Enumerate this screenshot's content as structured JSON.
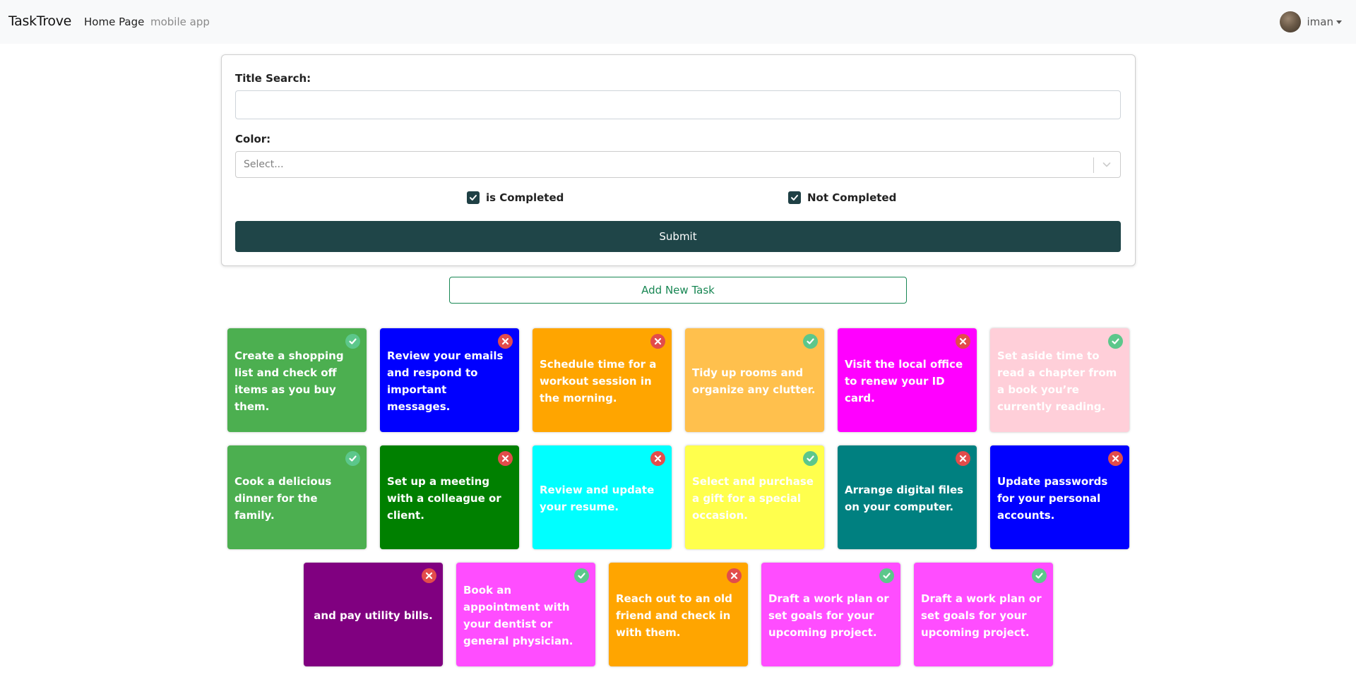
{
  "navbar": {
    "brand": "TaskTrove",
    "links": [
      {
        "label": "Home Page"
      },
      {
        "label": "mobile app"
      }
    ],
    "user": {
      "name": "iman"
    }
  },
  "filter": {
    "title_label": "Title Search:",
    "title_value": "",
    "color_label": "Color:",
    "color_placeholder": "Select...",
    "completed_label": "is Completed",
    "completed_checked": true,
    "not_completed_label": "Not Completed",
    "not_completed_checked": true,
    "submit_label": "Submit"
  },
  "add_task_label": "Add New Task",
  "tasks": [
    {
      "text": "Create a shopping list and check off items as you buy them.",
      "color": "#4caf50",
      "completed": true
    },
    {
      "text": "Review your emails and respond to important messages.",
      "color": "#0000ff",
      "completed": false
    },
    {
      "text": "Schedule time for a workout session in the morning.",
      "color": "#ffa500",
      "completed": false
    },
    {
      "text": "Tidy up rooms and organize any clutter.",
      "color": "#ffc04d",
      "completed": true
    },
    {
      "text": "Visit the local office to renew your ID card.",
      "color": "#ff00ff",
      "completed": false
    },
    {
      "text": "Set aside time to read a chapter from a book you’re currently reading.",
      "color": "#ffcfd9",
      "completed": true
    },
    {
      "text": "Cook a delicious dinner for the family.",
      "color": "#4caf50",
      "completed": true
    },
    {
      "text": "Set up a meeting with a colleague or client.",
      "color": "#008000",
      "completed": false
    },
    {
      "text": "Review and update your resume.",
      "color": "#00ffff",
      "completed": false
    },
    {
      "text": "Select and purchase a gift for a special occasion.",
      "color": "#ffff4d",
      "completed": true
    },
    {
      "text": "Arrange digital files on your computer.",
      "color": "#008080",
      "completed": false
    },
    {
      "text": "Update passwords for your personal accounts.",
      "color": "#0000ff",
      "completed": false
    },
    {
      "text": "and pay utility bills.",
      "color": "#800080",
      "completed": false
    },
    {
      "text": "Book an appointment with your dentist or general physician.",
      "color": "#ff4dff",
      "completed": true
    },
    {
      "text": "Reach out to an old friend and check in with them.",
      "color": "#ffa500",
      "completed": false
    },
    {
      "text": "Draft a work plan or set goals for your upcoming project.",
      "color": "#ff4dff",
      "completed": true
    },
    {
      "text": "Draft a work plan or set goals for your upcoming project.",
      "color": "#ff4dff",
      "completed": true
    }
  ]
}
